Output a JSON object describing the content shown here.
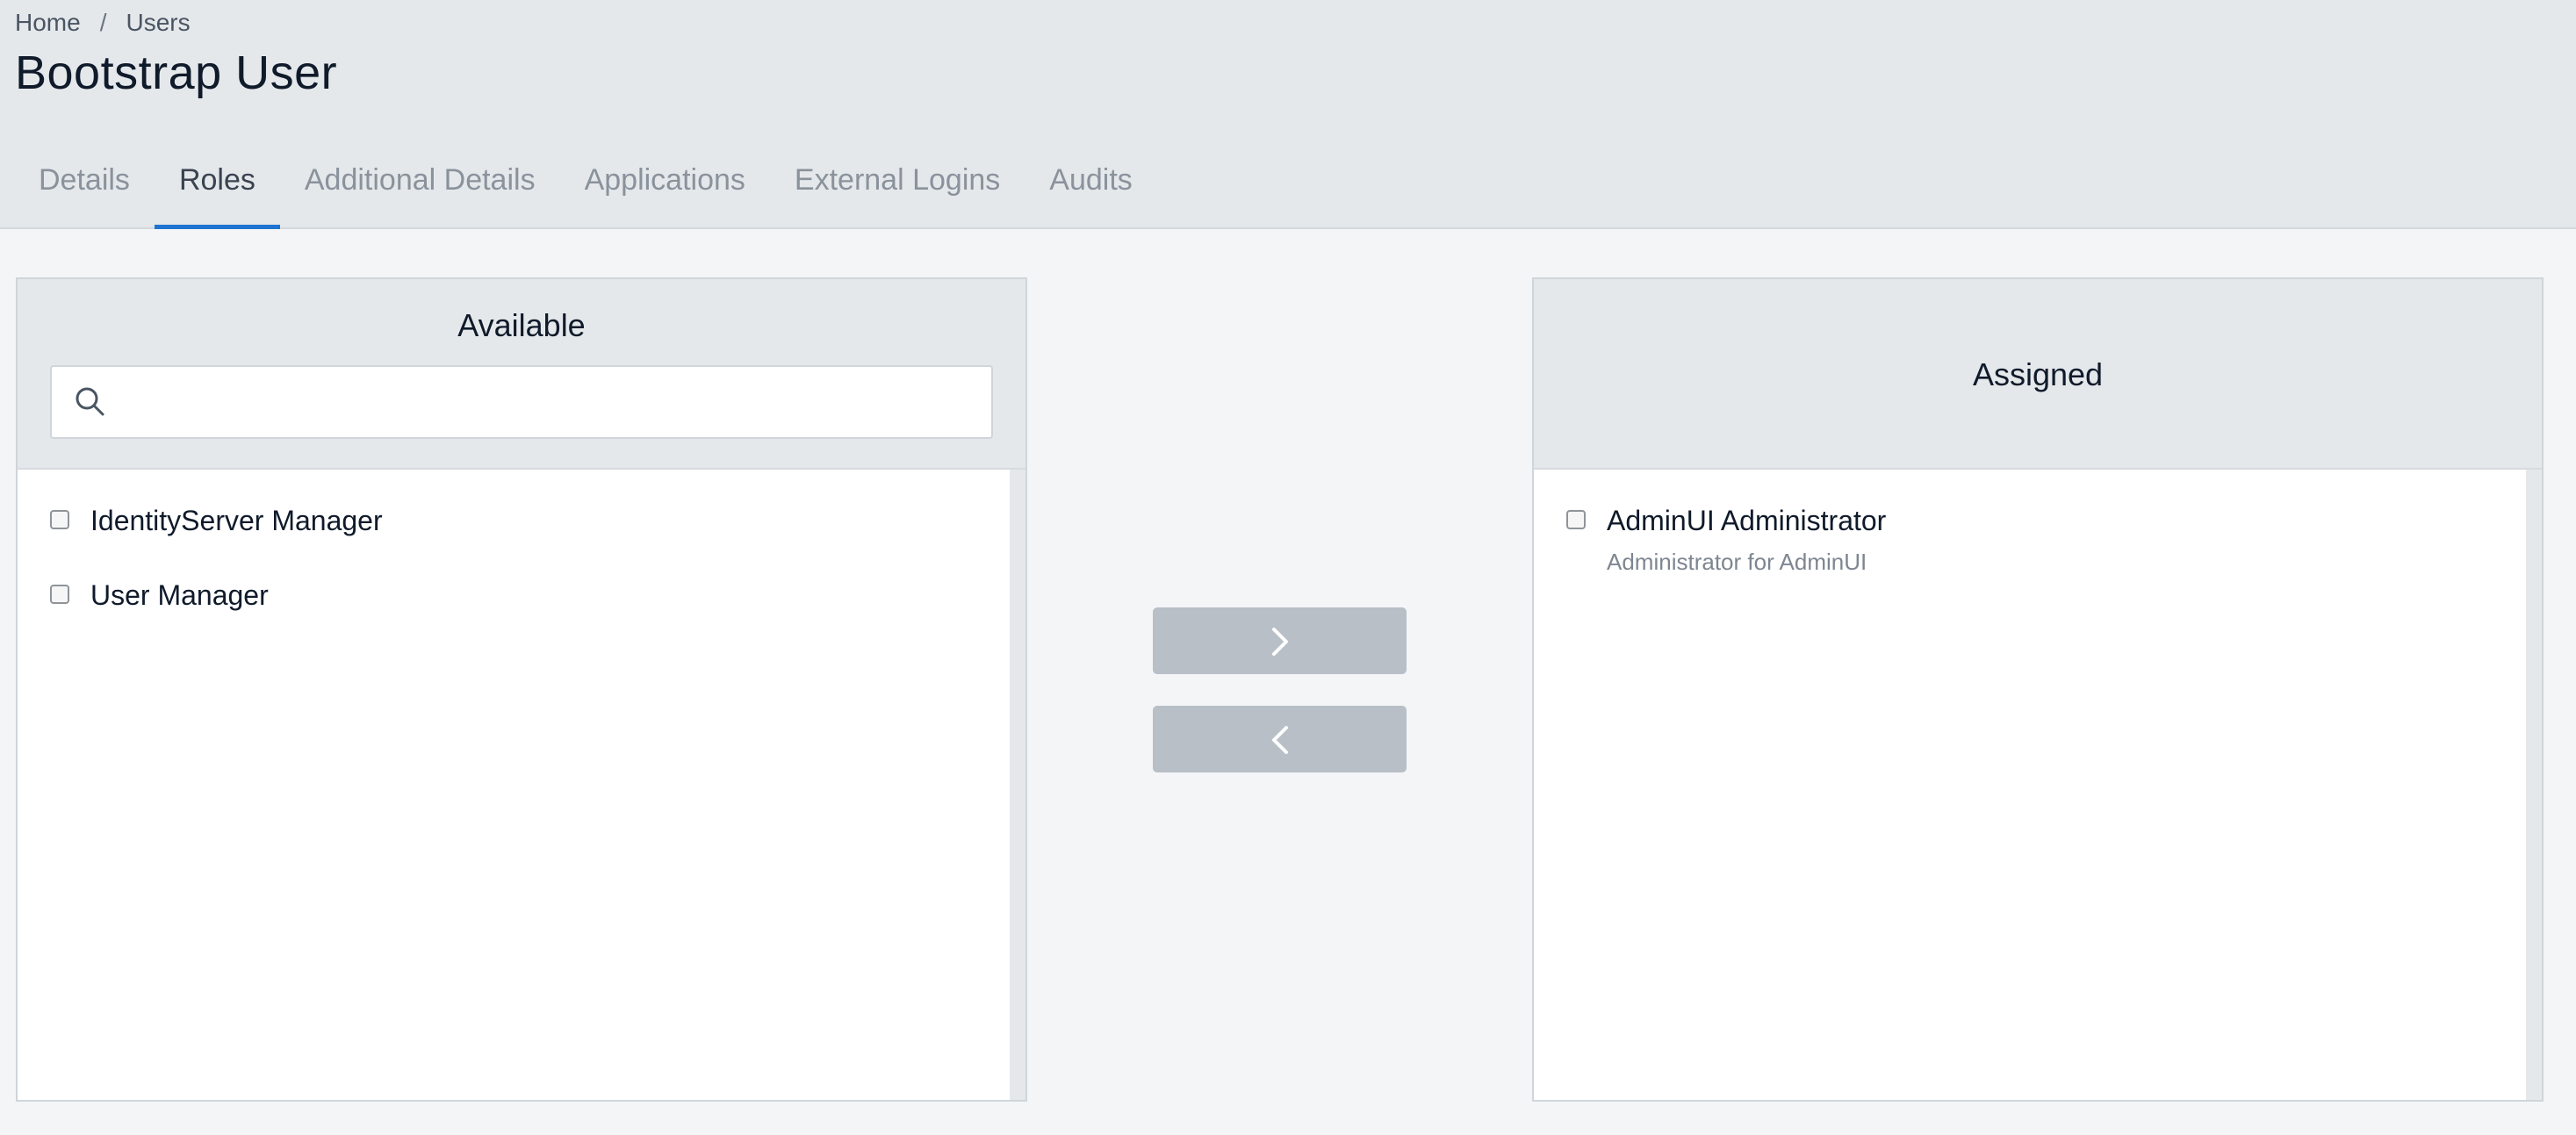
{
  "breadcrumb": {
    "home": "Home",
    "separator": "/",
    "users": "Users"
  },
  "page": {
    "title": "Bootstrap User"
  },
  "tabs": [
    {
      "label": "Details"
    },
    {
      "label": "Roles",
      "active": true
    },
    {
      "label": "Additional Details"
    },
    {
      "label": "Applications"
    },
    {
      "label": "External Logins"
    },
    {
      "label": "Audits"
    }
  ],
  "available": {
    "title": "Available",
    "search": {
      "value": "",
      "placeholder": ""
    },
    "items": [
      {
        "label": "IdentityServer Manager",
        "checked": false
      },
      {
        "label": "User Manager",
        "checked": false
      }
    ]
  },
  "assigned": {
    "title": "Assigned",
    "items": [
      {
        "label": "AdminUI Administrator",
        "description": "Administrator for AdminUI",
        "checked": false
      }
    ]
  },
  "actions": {
    "assign_icon": "chevron-right-icon",
    "unassign_icon": "chevron-left-icon"
  },
  "colors": {
    "accent": "#1f73d1",
    "header_bg": "#e5e8eb",
    "button_disabled": "#b8bfc7"
  }
}
